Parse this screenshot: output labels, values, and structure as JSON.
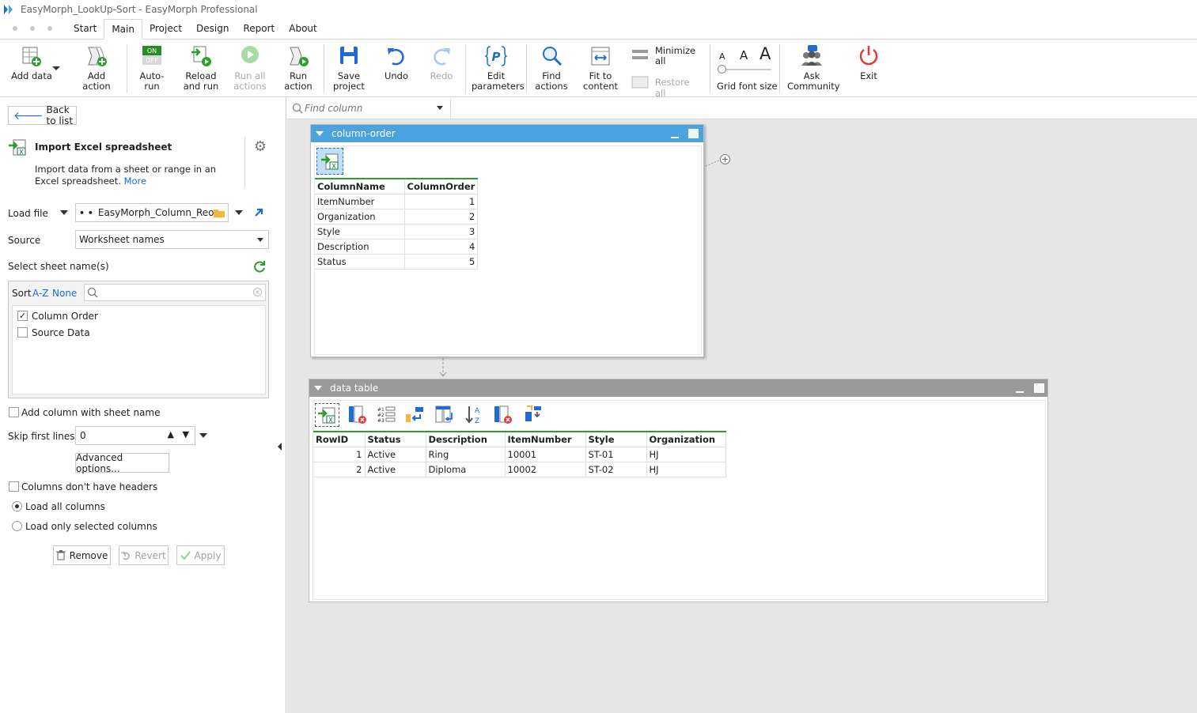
{
  "window": {
    "title": "EasyMorph_LookUp-Sort - EasyMorph Professional"
  },
  "menu": {
    "tabs": [
      {
        "label": "Start"
      },
      {
        "label": "Main"
      },
      {
        "label": "Project"
      },
      {
        "label": "Design"
      },
      {
        "label": "Report"
      },
      {
        "label": "About"
      }
    ],
    "active": "Main"
  },
  "ribbon": {
    "add_data": "Add data",
    "add_action": "Add action",
    "auto_run_l1": "Auto-",
    "auto_run_l2": "run",
    "auto_run_on": "ON",
    "auto_run_off": "OFF",
    "reload_l1": "Reload",
    "reload_l2": "and run",
    "run_all_l1": "Run all",
    "run_all_l2": "actions",
    "run_action_l1": "Run",
    "run_action_l2": "action",
    "save_l1": "Save",
    "save_l2": "project",
    "undo": "Undo",
    "redo": "Redo",
    "edit_params_l1": "Edit",
    "edit_params_l2": "parameters",
    "find_actions_l1": "Find",
    "find_actions_l2": "actions",
    "fit_l1": "Fit to",
    "fit_l2": "content",
    "minimize_l1": "Minimize",
    "minimize_l2": "all",
    "restore_all": "Restore all",
    "font_size": "Grid font size",
    "ask_l1": "Ask",
    "ask_l2": "Community",
    "exit": "Exit"
  },
  "left": {
    "back": "Back to list",
    "action_title": "Import Excel spreadsheet",
    "action_desc": "Import data from a sheet or range in an Excel spreadsheet.",
    "more_link": "More",
    "load_file_label": "Load file",
    "load_file_prefix": "• •",
    "load_file_value": "EasyMorph_Column_Reorde",
    "source_label": "Source",
    "source_value": "Worksheet names",
    "select_sheet_label": "Select sheet name(s)",
    "sort_label": "Sort",
    "sort_az": "A-Z",
    "sort_none": "None",
    "sheets": [
      {
        "name": "Column Order",
        "checked": true
      },
      {
        "name": "Source Data",
        "checked": false
      }
    ],
    "add_column_sheet": "Add column with sheet name",
    "skip_first_label": "Skip first lines",
    "skip_first_value": "0",
    "advanced": "Advanced options...",
    "no_headers": "Columns don't have headers",
    "load_all": "Load all columns",
    "load_selected": "Load only selected columns",
    "remove": "Remove",
    "revert": "Revert",
    "apply": "Apply"
  },
  "canvas": {
    "find_placeholder": "Find column",
    "table1": {
      "title": "column-order",
      "header_color": "#4aa3df",
      "columns": [
        "ColumnName",
        "ColumnOrder"
      ],
      "rows": [
        [
          "ItemNumber",
          "1"
        ],
        [
          "Organization",
          "2"
        ],
        [
          "Style",
          "3"
        ],
        [
          "Description",
          "4"
        ],
        [
          "Status",
          "5"
        ]
      ]
    },
    "table2": {
      "title": "data table",
      "header_color": "#9a9a9a",
      "columns": [
        "RowID",
        "Status",
        "Description",
        "ItemNumber",
        "Style",
        "Organization"
      ],
      "rows": [
        [
          "1",
          "Active",
          "Ring",
          "10001",
          "ST-01",
          "HJ"
        ],
        [
          "2",
          "Active",
          "Diploma",
          "10002",
          "ST-02",
          "HJ"
        ]
      ]
    }
  }
}
